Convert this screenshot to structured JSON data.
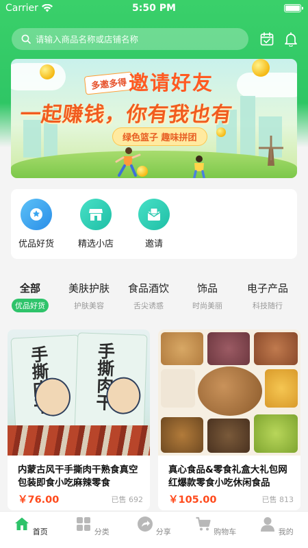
{
  "status": {
    "carrier": "Carrier",
    "time": "5:50 PM"
  },
  "search": {
    "placeholder": "请输入商品名称或店铺名称"
  },
  "banner": {
    "tag": "多邀多得",
    "title": "邀请好友",
    "slogan": "一起赚钱，你有我也有",
    "sub": "绿色篮子 趣味拼团"
  },
  "shortcuts": [
    {
      "label": "优品好货",
      "icon": "gear-badge-icon"
    },
    {
      "label": "精选小店",
      "icon": "store-icon"
    },
    {
      "label": "邀请",
      "icon": "invite-envelope-icon"
    }
  ],
  "categories": [
    {
      "title": "全部",
      "sub": "优品好货",
      "active": true
    },
    {
      "title": "美肤护肤",
      "sub": "护肤美容"
    },
    {
      "title": "食品酒饮",
      "sub": "舌尖诱惑"
    },
    {
      "title": "饰品",
      "sub": "时尚美丽"
    },
    {
      "title": "电子产品",
      "sub": "科技随行"
    }
  ],
  "products": [
    {
      "name": "内蒙古风干手撕肉干熟食真空包装即食小吃麻辣零食",
      "price": "￥76.00",
      "sold": "已售 692",
      "image_text": "手撕肉干"
    },
    {
      "name": "真心食品&零食礼盒大礼包网红爆款零食小吃休闲食品",
      "price": "￥105.00",
      "sold": "已售 813"
    }
  ],
  "tabbar": [
    {
      "label": "首页",
      "icon": "home-icon",
      "active": true
    },
    {
      "label": "分类",
      "icon": "grid-icon"
    },
    {
      "label": "分享",
      "icon": "share-icon"
    },
    {
      "label": "购物车",
      "icon": "cart-icon"
    },
    {
      "label": "我的",
      "icon": "user-icon"
    }
  ],
  "colors": {
    "brand": "#2ec36a",
    "price": "#ff4a1c",
    "banner_orange": "#f15c1f"
  }
}
